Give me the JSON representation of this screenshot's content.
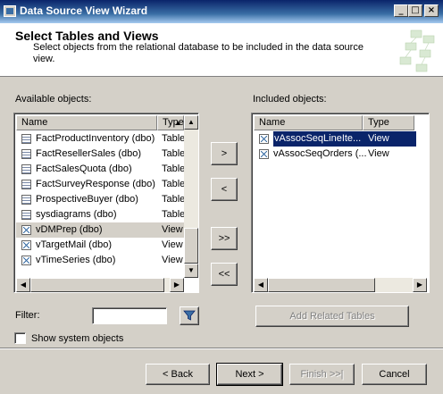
{
  "window": {
    "title": "Data Source View Wizard"
  },
  "header": {
    "title": "Select Tables and Views",
    "subtitle": "Select objects from the relational database to be included in the data source view."
  },
  "available": {
    "label": "Available objects:",
    "columns": {
      "name": "Name",
      "type": "Type"
    },
    "rows": [
      {
        "name": "FactProductInventory (dbo)",
        "type": "Table",
        "icon": "table-icon"
      },
      {
        "name": "FactResellerSales (dbo)",
        "type": "Table",
        "icon": "table-icon"
      },
      {
        "name": "FactSalesQuota (dbo)",
        "type": "Table",
        "icon": "table-icon"
      },
      {
        "name": "FactSurveyResponse (dbo)",
        "type": "Table",
        "icon": "table-icon"
      },
      {
        "name": "ProspectiveBuyer (dbo)",
        "type": "Table",
        "icon": "table-icon"
      },
      {
        "name": "sysdiagrams (dbo)",
        "type": "Table",
        "icon": "table-icon"
      },
      {
        "name": "vDMPrep (dbo)",
        "type": "View",
        "icon": "view-icon"
      },
      {
        "name": "vTargetMail (dbo)",
        "type": "View",
        "icon": "view-icon"
      },
      {
        "name": "vTimeSeries (dbo)",
        "type": "View",
        "icon": "view-icon"
      }
    ]
  },
  "included": {
    "label": "Included objects:",
    "columns": {
      "name": "Name",
      "type": "Type"
    },
    "rows": [
      {
        "name": "vAssocSeqLineIte...",
        "type": "View",
        "icon": "view-icon"
      },
      {
        "name": "vAssocSeqOrders (...",
        "type": "View",
        "icon": "view-icon"
      }
    ]
  },
  "transfer": {
    "add": ">",
    "remove": "<",
    "add_all": ">>",
    "remove_all": "<<"
  },
  "filter": {
    "label": "Filter:",
    "value": ""
  },
  "add_related_label": "Add Related Tables",
  "show_system_label": "Show system objects",
  "footer": {
    "back": "< Back",
    "next": "Next >",
    "finish": "Finish >>|",
    "cancel": "Cancel"
  }
}
